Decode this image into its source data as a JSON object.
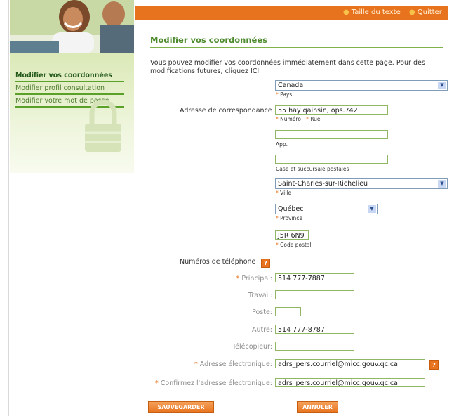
{
  "topbar": {
    "text_size": "Taille du texte",
    "quit": "Quitter"
  },
  "sidebar": {
    "items": [
      {
        "label": "Modifier vos coordonnées"
      },
      {
        "label": "Modifier profil consultation"
      },
      {
        "label": "Modifier votre mot de passe"
      }
    ]
  },
  "main": {
    "title": "Modifier vos coordonnées",
    "intro_text": "Vous pouvez modifier vos coordonnées immédiatement dans cette page. Pour des modifications futures, cliquez",
    "intro_link": "ICI"
  },
  "address": {
    "country": {
      "value": "Canada",
      "caption": "Pays"
    },
    "label": "Adresse de correspondance",
    "street": {
      "value": "55 hay qainsin, ops.742",
      "caption_number": "Numéro",
      "caption_street": "Rue"
    },
    "apt": {
      "value": "",
      "caption": "App."
    },
    "po_box": {
      "value": "",
      "caption": "Case et succursale postales"
    },
    "city": {
      "value": "Saint-Charles-sur-Richelieu",
      "caption": "Ville"
    },
    "province": {
      "value": "Québec",
      "caption": "Province"
    },
    "postal_code": {
      "value": "J5R 6N9",
      "caption": "Code postal"
    }
  },
  "phones": {
    "label": "Numéros de téléphone",
    "principal": {
      "label": "Principal:",
      "value": "514 777-7887"
    },
    "work": {
      "label": "Travail:",
      "value": ""
    },
    "ext": {
      "label": "Poste:",
      "value": ""
    },
    "other": {
      "label": "Autre:",
      "value": "514 777-8787"
    },
    "fax": {
      "label": "Télécopieur:",
      "value": ""
    }
  },
  "email": {
    "label": "Adresse électronique:",
    "value": "adrs_pers.courriel@micc.gouv.qc.ca",
    "confirm_label": "Confirmez l'adresse électronique:",
    "confirm_value": "adrs_pers.courriel@micc.gouv.qc.ca"
  },
  "buttons": {
    "save": "SAUVEGARDER",
    "cancel": "ANNULER"
  },
  "colors": {
    "accent": "#e8731e",
    "green": "#4d8a2d",
    "sidebar_line": "#5aa12a"
  }
}
